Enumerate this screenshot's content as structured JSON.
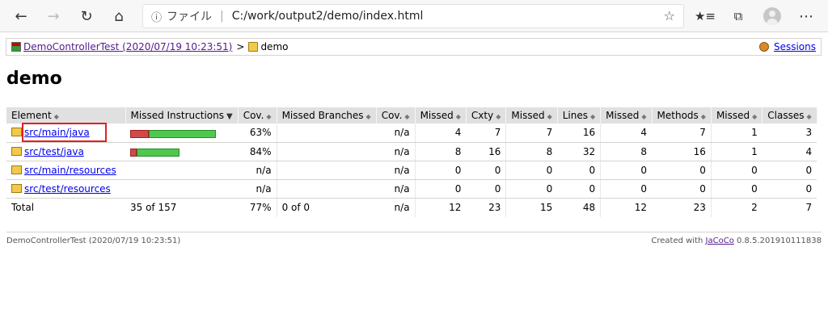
{
  "browser": {
    "address_prefix": "ファイル",
    "url": "C:/work/output2/demo/index.html"
  },
  "breadcrumb": {
    "session_link": "DemoControllerTest (2020/07/19 10:23:51)",
    "separator": ">",
    "current": "demo",
    "sessions_link": "Sessions"
  },
  "page_title": "demo",
  "table": {
    "headers": [
      "Element",
      "Missed Instructions",
      "Cov.",
      "Missed Branches",
      "Cov.",
      "Missed",
      "Cxty",
      "Missed",
      "Lines",
      "Missed",
      "Methods",
      "Missed",
      "Classes"
    ],
    "rows": [
      {
        "element": "src/main/java",
        "bar": {
          "missed": 35,
          "covered": 122
        },
        "cov1": "63%",
        "missed_branches": "",
        "cov2": "n/a",
        "m_cxty": "4",
        "cxty": "7",
        "m_lines": "7",
        "lines": "16",
        "m_methods": "4",
        "methods": "7",
        "m_classes": "1",
        "classes": "3"
      },
      {
        "element": "src/test/java",
        "bar": {
          "missed": 14,
          "covered": 78
        },
        "cov1": "84%",
        "missed_branches": "",
        "cov2": "n/a",
        "m_cxty": "8",
        "cxty": "16",
        "m_lines": "8",
        "lines": "32",
        "m_methods": "8",
        "methods": "16",
        "m_classes": "1",
        "classes": "4"
      },
      {
        "element": "src/main/resources",
        "bar": null,
        "cov1": "n/a",
        "missed_branches": "",
        "cov2": "n/a",
        "m_cxty": "0",
        "cxty": "0",
        "m_lines": "0",
        "lines": "0",
        "m_methods": "0",
        "methods": "0",
        "m_classes": "0",
        "classes": "0"
      },
      {
        "element": "src/test/resources",
        "bar": null,
        "cov1": "n/a",
        "missed_branches": "",
        "cov2": "n/a",
        "m_cxty": "0",
        "cxty": "0",
        "m_lines": "0",
        "lines": "0",
        "m_methods": "0",
        "methods": "0",
        "m_classes": "0",
        "classes": "0"
      }
    ],
    "total": {
      "label": "Total",
      "missed_instr": "35 of 157",
      "cov1": "77%",
      "missed_branches": "0 of 0",
      "cov2": "n/a",
      "m_cxty": "12",
      "cxty": "23",
      "m_lines": "15",
      "lines": "48",
      "m_methods": "12",
      "methods": "23",
      "m_classes": "2",
      "classes": "7"
    }
  },
  "footer": {
    "left": "DemoControllerTest (2020/07/19 10:23:51)",
    "created_with": "Created with",
    "tool_link": "JaCoCo",
    "version": "0.8.5.201910111838"
  },
  "colors": {
    "missed_bar": "#d14a4a",
    "covered_bar": "#4ec94e",
    "highlight": "#e02020"
  }
}
